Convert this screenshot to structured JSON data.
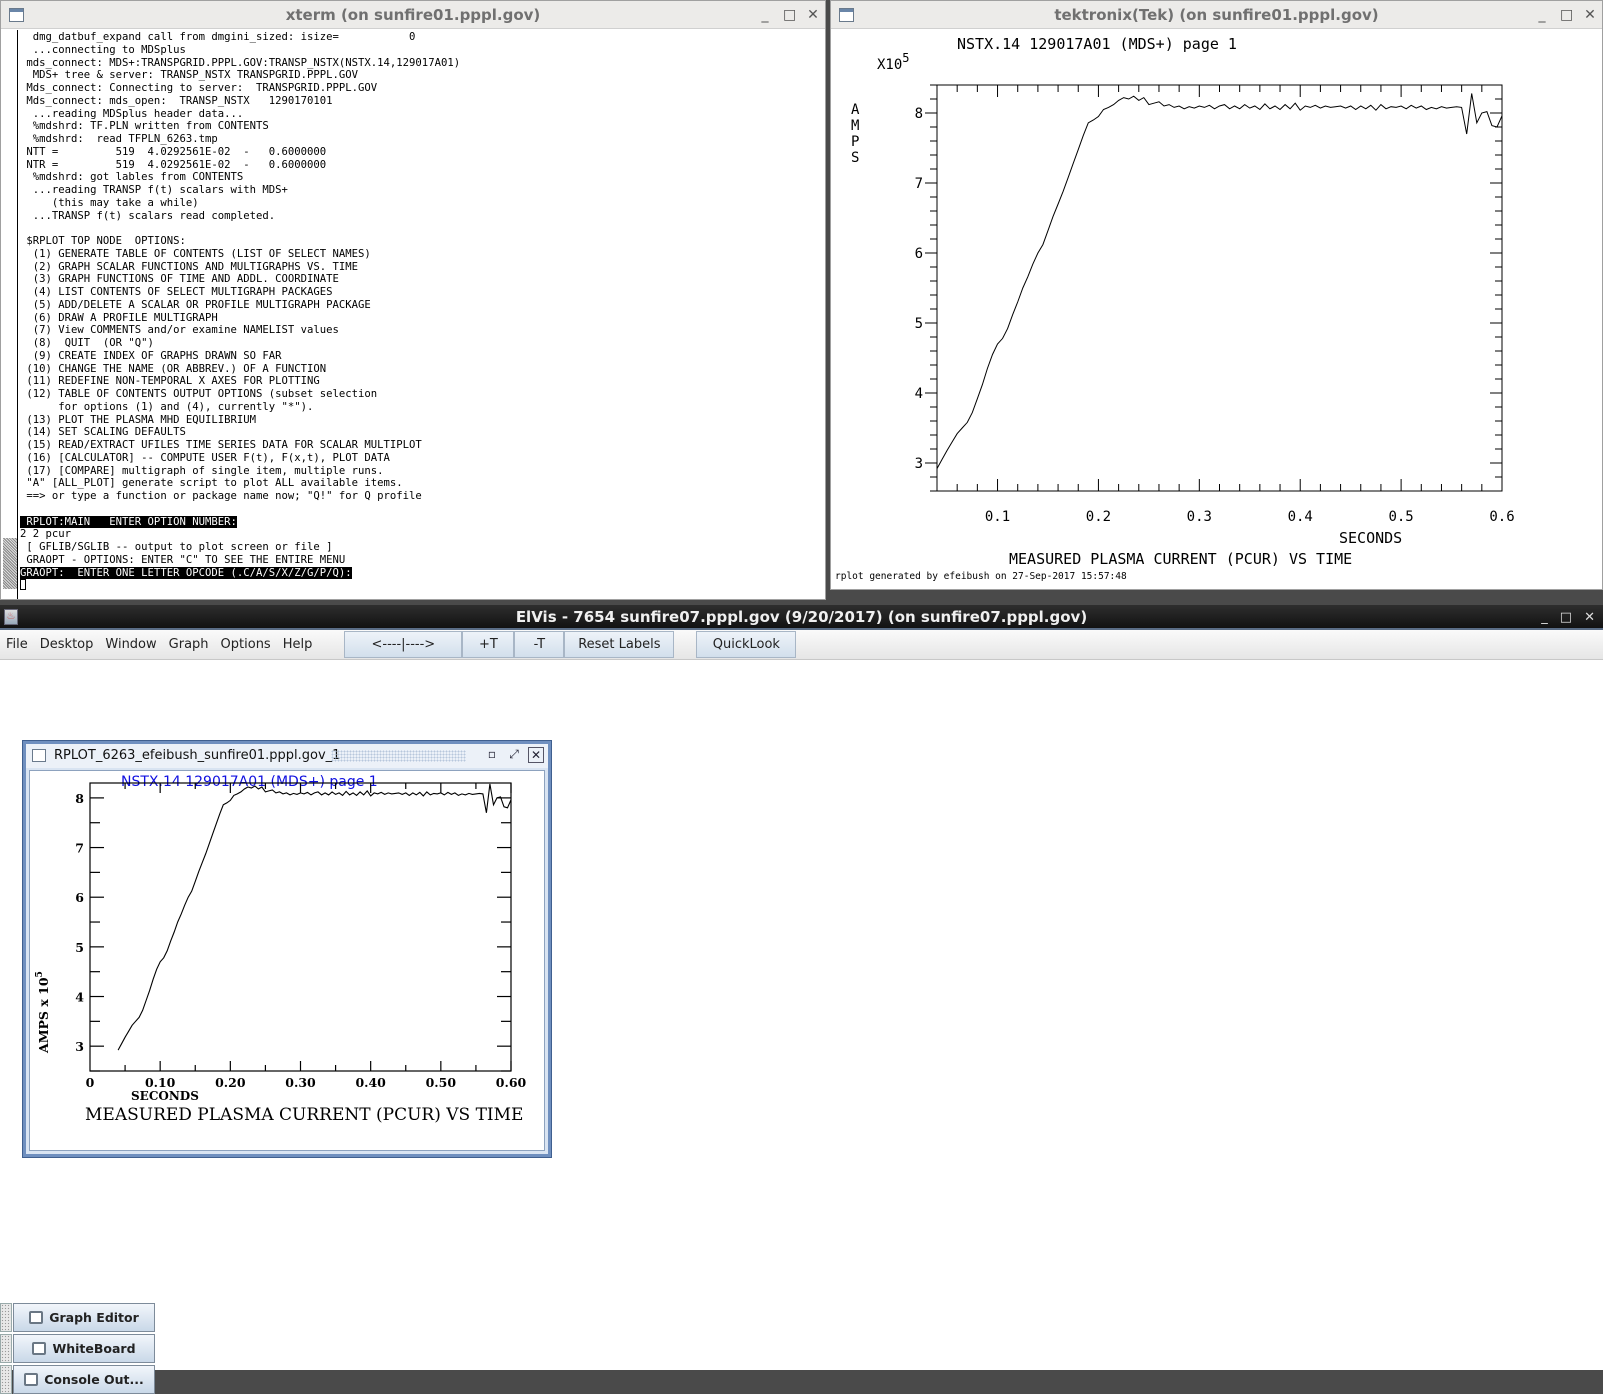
{
  "xterm": {
    "title": "xterm (on sunfire01.pppl.gov)",
    "lines": [
      "  dmg_datbuf_expand call from dmgini_sized: isize=           0",
      "  ...connecting to MDSplus",
      " mds_connect: MDS+:TRANSPGRID.PPPL.GOV:TRANSP_NSTX(NSTX.14,129017A01)",
      "  MDS+ tree & server: TRANSP_NSTX TRANSPGRID.PPPL.GOV",
      " Mds_connect: Connecting to server:  TRANSPGRID.PPPL.GOV",
      " Mds_connect: mds_open:  TRANSP_NSTX   1290170101",
      "  ...reading MDSplus header data...",
      "  %mdshrd: TF.PLN written from CONTENTS",
      "  %mdshrd:  read TFPLN_6263.tmp",
      " NTT =         519  4.0292561E-02  -   0.6000000",
      " NTR =         519  4.0292561E-02  -   0.6000000",
      "  %mdshrd: got lables from CONTENTS",
      "  ...reading TRANSP f(t) scalars with MDS+",
      "     (this may take a while)",
      "  ...TRANSP f(t) scalars read completed.",
      "",
      " $RPLOT TOP NODE  OPTIONS:",
      "  (1) GENERATE TABLE OF CONTENTS (LIST OF SELECT NAMES)",
      "  (2) GRAPH SCALAR FUNCTIONS AND MULTIGRAPHS VS. TIME",
      "  (3) GRAPH FUNCTIONS OF TIME AND ADDL. COORDINATE",
      "  (4) LIST CONTENTS OF SELECT MULTIGRAPH PACKAGES",
      "  (5) ADD/DELETE A SCALAR OR PROFILE MULTIGRAPH PACKAGE",
      "  (6) DRAW A PROFILE MULTIGRAPH",
      "  (7) View COMMENTS and/or examine NAMELIST values",
      "  (8)  QUIT  (OR \"Q\")",
      "  (9) CREATE INDEX OF GRAPHS DRAWN SO FAR",
      " (10) CHANGE THE NAME (OR ABBREV.) OF A FUNCTION",
      " (11) REDEFINE NON-TEMPORAL X AXES FOR PLOTTING",
      " (12) TABLE OF CONTENTS OUTPUT OPTIONS (subset selection",
      "      for options (1) and (4), currently \"*\").",
      " (13) PLOT THE PLASMA MHD EQUILIBRIUM",
      " (14) SET SCALING DEFAULTS",
      " (15) READ/EXTRACT UFILES TIME SERIES DATA FOR SCALAR MULTIPLOT",
      " (16) [CALCULATOR] -- COMPUTE USER F(t), F(x,t), PLOT DATA",
      " (17) [COMPARE] multigraph of single item, multiple runs.",
      " \"A\" [ALL_PLOT] generate script to plot ALL available items.",
      " ==> or type a function or package name now; \"Q!\" for Q profile",
      ""
    ],
    "prompt_main": " RPLOT:MAIN   ENTER OPTION NUMBER:",
    "user_input": "2 2 pcur",
    "after_lines": [
      " [ GFLIB/SGLIB -- output to plot screen or file ]",
      " GRAOPT - OPTIONS: ENTER \"C\" TO SEE THE ENTIRE MENU"
    ],
    "prompt_opcode": "GRAOPT:  ENTER ONE LETTER OPCODE (.C/A/S/X/Z/G/P/Q):"
  },
  "tek": {
    "title": "tektronix(Tek) (on sunfire01.pppl.gov)",
    "footer": "rplot generated by efeibush on 27-Sep-2017 15:57:48"
  },
  "elvis": {
    "title": "ElVis - 7654 sunfire07.pppl.gov   (9/20/2017) (on sunfire07.pppl.gov)",
    "menu": [
      "File",
      "Desktop",
      "Window",
      "Graph",
      "Options",
      "Help"
    ],
    "toolbar": {
      "pan": "<----|---->",
      "plus_t": "+T",
      "minus_t": "-T",
      "reset_labels": "Reset Labels",
      "quicklook": "QuickLook"
    },
    "internal_frame_title": "RPLOT_6263_efeibush_sunfire01.pppl.gov_1",
    "taskbar": [
      "Graph Editor",
      "WhiteBoard",
      "Console Out..."
    ]
  },
  "colors": {
    "elvis_title_blue": "#1010e0",
    "frame_border": "#6f8fbf"
  },
  "chart_data": [
    {
      "id": "tek-plot",
      "type": "line",
      "title": "NSTX.14 129017A01 (MDS+) page 1",
      "xlabel": "SECONDS",
      "ylabel": "AMPS",
      "y_multiplier": "X10^5",
      "caption": "MEASURED PLASMA CURRENT (PCUR) VS TIME",
      "xlim": [
        0.04,
        0.6
      ],
      "ylim": [
        2.6,
        8.4
      ],
      "xticks": [
        "0.1",
        "0.2",
        "0.3",
        "0.4",
        "0.5",
        "0.6"
      ],
      "xtick_values": [
        0.1,
        0.2,
        0.3,
        0.4,
        0.5,
        0.6
      ],
      "yticks": [
        "3",
        "4",
        "5",
        "6",
        "7",
        "8"
      ],
      "ytick_values": [
        3,
        4,
        5,
        6,
        7,
        8
      ],
      "grid": false,
      "series": [
        {
          "name": "PCUR",
          "x": [
            0.04,
            0.045,
            0.05,
            0.055,
            0.06,
            0.065,
            0.07,
            0.075,
            0.08,
            0.085,
            0.09,
            0.095,
            0.1,
            0.105,
            0.11,
            0.115,
            0.12,
            0.125,
            0.13,
            0.135,
            0.14,
            0.145,
            0.15,
            0.155,
            0.16,
            0.165,
            0.17,
            0.175,
            0.18,
            0.185,
            0.19,
            0.195,
            0.2,
            0.205,
            0.21,
            0.215,
            0.22,
            0.225,
            0.23,
            0.235,
            0.24,
            0.245,
            0.25,
            0.255,
            0.26,
            0.265,
            0.27,
            0.275,
            0.28,
            0.285,
            0.29,
            0.295,
            0.3,
            0.305,
            0.31,
            0.315,
            0.32,
            0.325,
            0.33,
            0.335,
            0.34,
            0.345,
            0.35,
            0.355,
            0.36,
            0.365,
            0.37,
            0.375,
            0.38,
            0.385,
            0.39,
            0.395,
            0.4,
            0.405,
            0.41,
            0.415,
            0.42,
            0.425,
            0.43,
            0.435,
            0.44,
            0.445,
            0.45,
            0.455,
            0.46,
            0.465,
            0.47,
            0.475,
            0.48,
            0.485,
            0.49,
            0.495,
            0.5,
            0.505,
            0.51,
            0.515,
            0.52,
            0.525,
            0.53,
            0.535,
            0.54,
            0.545,
            0.55,
            0.555,
            0.56,
            0.565,
            0.57,
            0.575,
            0.58,
            0.585,
            0.59,
            0.595,
            0.6
          ],
          "y": [
            2.92,
            3.05,
            3.18,
            3.3,
            3.42,
            3.5,
            3.58,
            3.72,
            3.92,
            4.12,
            4.35,
            4.55,
            4.7,
            4.78,
            4.92,
            5.12,
            5.3,
            5.5,
            5.66,
            5.84,
            6.0,
            6.12,
            6.32,
            6.52,
            6.7,
            6.88,
            7.08,
            7.28,
            7.48,
            7.68,
            7.86,
            7.9,
            7.95,
            8.05,
            8.08,
            8.12,
            8.18,
            8.22,
            8.2,
            8.24,
            8.18,
            8.22,
            8.12,
            8.14,
            8.16,
            8.1,
            8.12,
            8.08,
            8.1,
            8.06,
            8.09,
            8.07,
            8.1,
            8.08,
            8.11,
            8.06,
            8.1,
            8.12,
            8.06,
            8.1,
            8.06,
            8.12,
            8.07,
            8.1,
            8.05,
            8.13,
            8.06,
            8.1,
            8.05,
            8.12,
            8.06,
            8.14,
            8.04,
            8.1,
            8.08,
            8.11,
            8.07,
            8.1,
            8.08,
            8.09,
            8.1,
            8.07,
            8.1,
            8.05,
            8.1,
            8.06,
            8.11,
            8.04,
            8.12,
            8.06,
            8.09,
            8.08,
            8.1,
            8.06,
            8.11,
            8.07,
            8.1,
            8.05,
            8.08,
            8.06,
            8.09,
            8.07,
            8.08,
            8.09,
            8.08,
            7.7,
            8.28,
            7.86,
            8.0,
            8.02,
            7.82,
            7.8,
            7.96
          ]
        }
      ]
    },
    {
      "id": "elvis-plot",
      "type": "line",
      "title": "NSTX.14 129017A01 (MDS+) page 1",
      "xlabel": "SECONDS",
      "ylabel": "AMPS x 10^5",
      "caption": "MEASURED PLASMA CURRENT (PCUR) VS TIME",
      "xlim": [
        0,
        0.6
      ],
      "ylim": [
        2.5,
        8.3
      ],
      "xticks": [
        "0",
        "0.10",
        "0.20",
        "0.30",
        "0.40",
        "0.50",
        "0.60"
      ],
      "xtick_values": [
        0,
        0.1,
        0.2,
        0.3,
        0.4,
        0.5,
        0.6
      ],
      "yticks": [
        "3",
        "4",
        "5",
        "6",
        "7",
        "8"
      ],
      "ytick_values": [
        3,
        4,
        5,
        6,
        7,
        8
      ],
      "grid": false,
      "series_ref": "same PCUR series as tek-plot"
    }
  ]
}
